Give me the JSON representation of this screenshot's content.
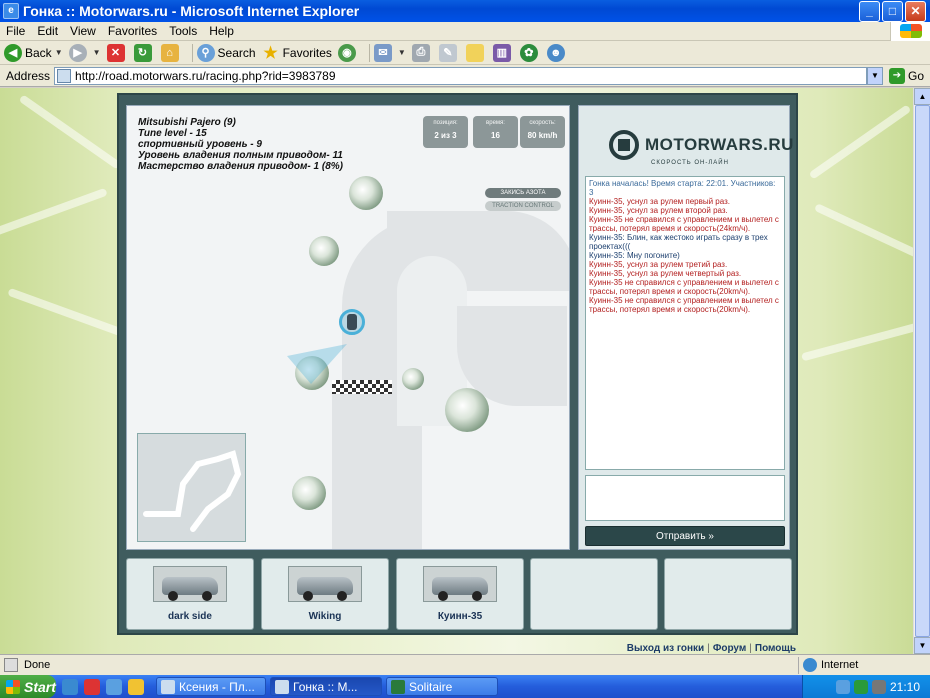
{
  "window": {
    "title": "Гонка :: Motorwars.ru - Microsoft Internet Explorer",
    "icon": "ie-page-icon"
  },
  "menu": [
    "File",
    "Edit",
    "View",
    "Favorites",
    "Tools",
    "Help"
  ],
  "toolbar": {
    "back": "Back",
    "search": "Search",
    "favorites": "Favorites"
  },
  "address": {
    "label": "Address",
    "url": "http://road.motorwars.ru/racing.php?rid=3983789",
    "go": "Go"
  },
  "game": {
    "car_info": [
      "Mitsubishi Pajero (9)",
      "Tune level - 15",
      "спортивный уровень - 9",
      "Уровень владения полным приводом- 11",
      "Мастерство владения приводом- 1 (8%)"
    ],
    "stats": [
      {
        "caption": "позиция:",
        "value": "2 из 3"
      },
      {
        "caption": "время:",
        "value": "16"
      },
      {
        "caption": "скорость:",
        "value": "80 km/h"
      }
    ],
    "buttons": {
      "nitro": "ЗАКИСЬ АЗОТА",
      "traction": "TRACTION CONTROL"
    }
  },
  "chat": {
    "brand": "MOTORWARS.RU",
    "slogan": "СКОРОСТЬ ОН-ЛАЙН",
    "lines": [
      {
        "type": "sys",
        "text": "Гонка началась! Время старта: 22:01. Участников: 3"
      },
      {
        "type": "event",
        "text": "Куинн-35, уснул за рулем первый раз."
      },
      {
        "type": "event",
        "text": "Куинн-35, уснул за рулем второй раз."
      },
      {
        "type": "event",
        "text": "Куинн-35 не справился с управлением и вылетел с трассы, потерял время и скорость(24km/ч)."
      },
      {
        "type": "user",
        "text": "Куинн-35: Блин, как жестоко играть сразу в трех проектах((("
      },
      {
        "type": "user",
        "text": "Куинн-35: Мну погоните)"
      },
      {
        "type": "event",
        "text": "Куинн-35, уснул за рулем третий раз."
      },
      {
        "type": "event",
        "text": "Куинн-35, уснул за рулем четвертый раз."
      },
      {
        "type": "event",
        "text": "Куинн-35 не справился с управлением и вылетел с трассы, потерял время и скорость(20km/ч)."
      },
      {
        "type": "event",
        "text": "Куинн-35 не справился с управлением и вылетел с трассы, потерял время и скорость(20km/ч)."
      }
    ],
    "send": "Отправить »"
  },
  "cars": [
    "dark side",
    "Wiking",
    "Куинн-35",
    "",
    ""
  ],
  "footer": {
    "exit": "Выход из гонки",
    "forum": "Форум",
    "help": "Помощь"
  },
  "status": {
    "text": "Done",
    "zone": "Internet"
  },
  "taskbar": {
    "start": "Start",
    "tasks": [
      "Ксения - Пл...",
      "Гонка :: М...",
      "Solitaire"
    ],
    "clock": "21:10"
  }
}
